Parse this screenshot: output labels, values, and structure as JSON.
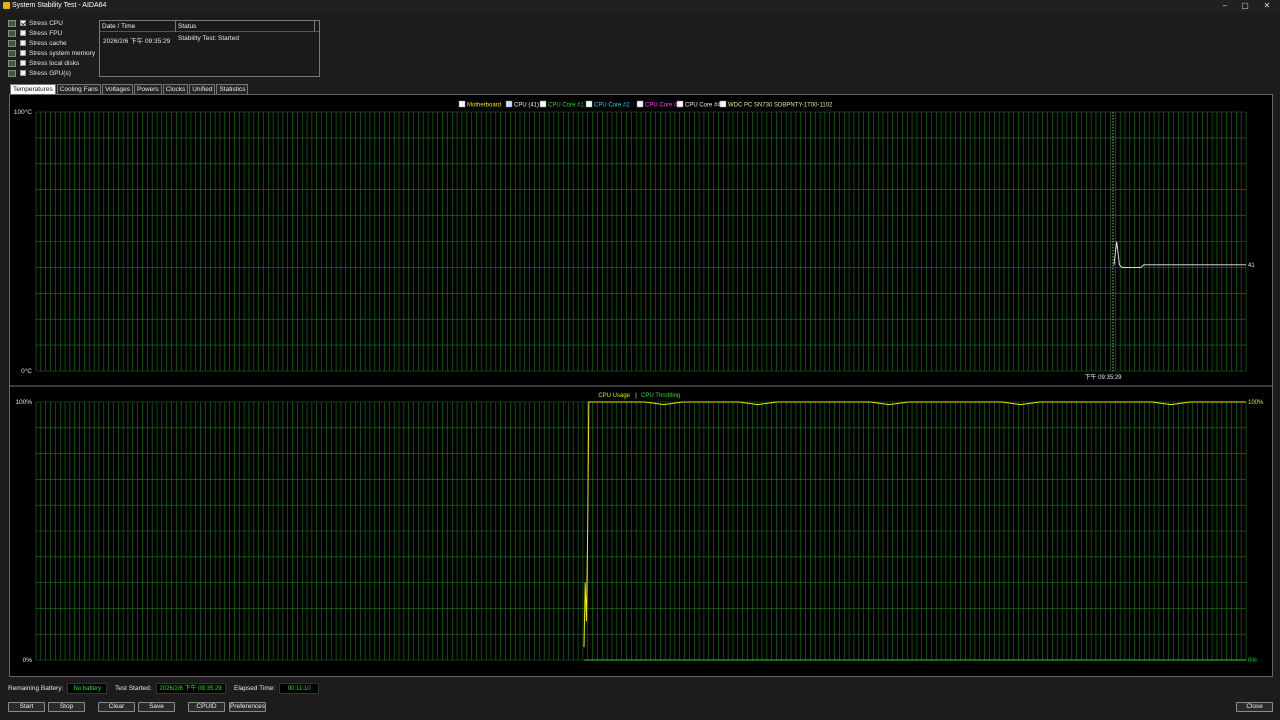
{
  "window": {
    "title": "System Stability Test - AIDA64",
    "minimize": "–",
    "maximize": "▢",
    "close": "✕"
  },
  "options": [
    {
      "label": "Stress CPU",
      "checked": true
    },
    {
      "label": "Stress FPU",
      "checked": false
    },
    {
      "label": "Stress cache",
      "checked": false
    },
    {
      "label": "Stress system memory",
      "checked": false
    },
    {
      "label": "Stress local disks",
      "checked": false
    },
    {
      "label": "Stress GPU(s)",
      "checked": false
    }
  ],
  "status_table": {
    "headers": [
      "Date / Time",
      "Status"
    ],
    "rows": [
      {
        "datetime": "2026/2/6 下午 09:35:29",
        "status": "Stability Test: Started"
      }
    ]
  },
  "tabs": [
    "Temperatures",
    "Cooling Fans",
    "Voltages",
    "Powers",
    "Clocks",
    "Unified",
    "Statistics"
  ],
  "active_tab": "Temperatures",
  "legend_top": [
    {
      "label": "Motherboard",
      "checked": false,
      "color": "#e8e800"
    },
    {
      "label": "CPU (41)",
      "checked": true,
      "color": "#f0f0f0"
    },
    {
      "label": "CPU Core #1",
      "checked": false,
      "color": "#22dd22"
    },
    {
      "label": "CPU Core #2",
      "checked": false,
      "color": "#1ad6ff"
    },
    {
      "label": "CPU Core #3",
      "checked": false,
      "color": "#ff3cff"
    },
    {
      "label": "CPU Core #4",
      "checked": false,
      "color": "#f0f0f0"
    },
    {
      "label": "WDC PC SN730 SDBPNTY-1T00-1102",
      "checked": false,
      "color": "#e6e6a0"
    }
  ],
  "legend_bottom": {
    "usage": "CPU Usage",
    "separator": "|",
    "throttling": "CPU Throttling",
    "usage_color": "#e8e800",
    "throttling_color": "#22dd22"
  },
  "chart_data": [
    {
      "type": "line",
      "name": "temperatures",
      "ymin_label": "0°C",
      "ymax_label": "100°C",
      "ylim": [
        0,
        100
      ],
      "marker_time": "下午 09:35:29",
      "current_value_label": "41",
      "series": [
        {
          "name": "CPU (41)",
          "color": "#f0f0f0",
          "values": [
            41,
            50,
            41,
            40,
            40,
            40,
            40,
            40,
            40,
            40,
            40,
            41,
            41,
            41,
            41,
            41,
            41,
            41,
            41,
            41,
            41,
            41,
            41,
            41,
            41,
            41,
            41,
            41,
            41,
            41,
            41,
            41,
            41,
            41,
            41,
            41,
            41,
            41,
            41,
            41,
            41,
            41,
            41,
            41,
            41,
            41,
            41,
            41,
            41,
            41
          ]
        }
      ]
    },
    {
      "type": "line",
      "name": "cpu-usage",
      "ymin_label": "0%",
      "ymax_label": "100%",
      "ylim": [
        0,
        100
      ],
      "right_top_label": "100%",
      "right_bottom_label": "0%",
      "series": [
        {
          "name": "CPU Usage",
          "color": "#e8e800",
          "values": [
            5,
            30,
            15,
            48,
            100,
            100,
            100,
            100,
            99,
            100,
            100,
            100,
            100,
            99,
            100,
            100,
            100,
            100,
            100,
            100,
            99,
            100,
            100,
            100,
            100,
            100,
            100,
            99,
            100,
            100,
            100,
            100,
            100,
            100,
            100,
            99,
            100,
            100,
            100,
            100
          ]
        },
        {
          "name": "CPU Throttling",
          "color": "#22dd22",
          "values": [
            0,
            0,
            0,
            0,
            0,
            0,
            0,
            0,
            0,
            0,
            0,
            0,
            0,
            0,
            0,
            0,
            0,
            0,
            0,
            0,
            0,
            0,
            0,
            0,
            0,
            0,
            0,
            0,
            0,
            0,
            0,
            0,
            0,
            0,
            0,
            0,
            0,
            0,
            0,
            0
          ]
        }
      ]
    }
  ],
  "footer": {
    "battery_label": "Remaining Battery:",
    "battery_value": "No battery",
    "started_label": "Test Started:",
    "started_value": "2026/2/6 下午 09:35:29",
    "elapsed_label": "Elapsed Time:",
    "elapsed_value": "00:11:10"
  },
  "buttons": {
    "start": "Start",
    "stop": "Stop",
    "clear": "Clear",
    "save": "Save",
    "cpuid": "CPUID",
    "preferences": "Preferences",
    "close": "Close"
  }
}
